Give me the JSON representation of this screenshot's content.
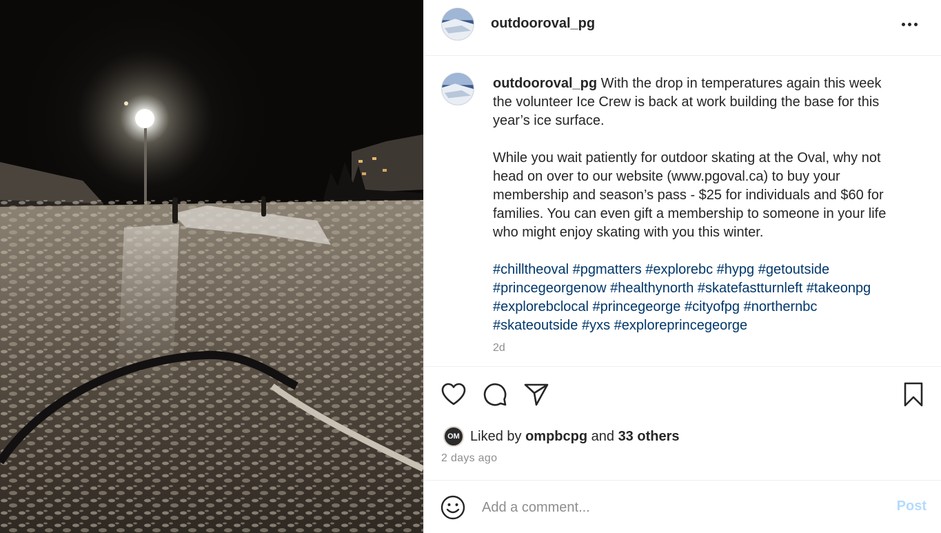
{
  "post": {
    "username": "outdooroval_pg",
    "caption": {
      "username": "outdooroval_pg",
      "lines": [
        "With the drop in temperatures again this week",
        "the volunteer Ice Crew is back at work building the base for this",
        "year’s ice surface."
      ],
      "paragraph2": [
        "While you wait patiently for outdoor skating at the Oval, why not",
        "head on over to our website (www.pgoval.ca) to buy your",
        "membership and season’s pass - $25 for individuals and $60 for",
        "families. You can even gift a membership to someone in your life",
        "who might enjoy skating with you this winter."
      ],
      "hashtag_lines": [
        [
          "#chilltheoval",
          "#pgmatters",
          "#explorebc",
          "#hypg",
          "#getoutside"
        ],
        [
          "#princegeorgenow",
          "#healthynorth",
          "#skatefastturnleft",
          "#takeonpg"
        ],
        [
          "#explorebclocal",
          "#princegeorge",
          "#cityofpg",
          "#northernbc"
        ],
        [
          "#skateoutside",
          "#yxs",
          "#exploreprincegeorge"
        ]
      ],
      "time": "2d"
    },
    "likes": {
      "prefix": "Liked by",
      "user": "ompbcpg",
      "joiner": "and",
      "others": "33 others",
      "avatar_text": "OM"
    },
    "date": "2 days ago",
    "comment": {
      "placeholder": "Add a comment...",
      "post_label": "Post"
    }
  },
  "icons": {
    "more": "more-horizontal-icon",
    "like": "heart-icon",
    "comment": "comment-bubble-icon",
    "share": "paper-plane-icon",
    "save": "bookmark-icon",
    "emoji": "smiley-face-icon"
  },
  "colors": {
    "hashtag": "#00376b",
    "muted": "#8e8e8e",
    "post_button_disabled": "#b3dbff",
    "text": "#262626"
  }
}
